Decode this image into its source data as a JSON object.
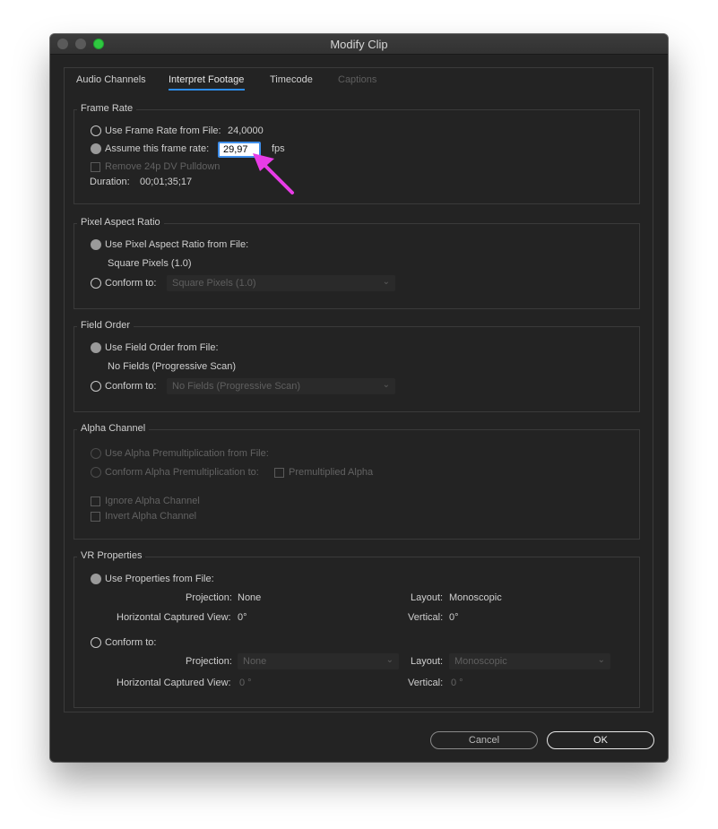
{
  "window": {
    "title": "Modify Clip"
  },
  "tabs": [
    "Audio Channels",
    "Interpret Footage",
    "Timecode",
    "Captions"
  ],
  "frame_rate": {
    "label": "Frame Rate",
    "use_file_label": "Use Frame Rate from File:",
    "use_file_value": "24,0000",
    "assume_label": "Assume this frame rate:",
    "assume_value": "29,97",
    "fps_unit": "fps",
    "pulldown_label": "Remove 24p DV Pulldown",
    "duration_label": "Duration:",
    "duration_value": "00;01;35;17"
  },
  "pixel_aspect": {
    "label": "Pixel Aspect Ratio",
    "use_file_label": "Use Pixel Aspect Ratio from File:",
    "file_value": "Square Pixels (1.0)",
    "conform_label": "Conform to:",
    "conform_value": "Square Pixels (1.0)"
  },
  "field_order": {
    "label": "Field Order",
    "use_file_label": "Use Field Order from File:",
    "file_value": "No Fields (Progressive Scan)",
    "conform_label": "Conform to:",
    "conform_value": "No Fields (Progressive Scan)"
  },
  "alpha": {
    "label": "Alpha Channel",
    "use_premult_label": "Use Alpha Premultiplication from File:",
    "conform_premult_label": "Conform Alpha Premultiplication to:",
    "premultiplied_label": "Premultiplied Alpha",
    "ignore_label": "Ignore Alpha Channel",
    "invert_label": "Invert Alpha Channel"
  },
  "vr": {
    "label": "VR Properties",
    "use_file_label": "Use Properties from File:",
    "projection_label": "Projection:",
    "projection_value": "None",
    "layout_label": "Layout:",
    "layout_value": "Monoscopic",
    "hcv_label": "Horizontal Captured View:",
    "hcv_value": "0°",
    "vertical_label": "Vertical:",
    "vertical_value": "0°",
    "conform_label": "Conform to:",
    "conform_projection": "None",
    "conform_layout": "Monoscopic",
    "conform_hcv": "0 °",
    "conform_vertical": "0 °"
  },
  "buttons": {
    "cancel": "Cancel",
    "ok": "OK"
  },
  "colors": {
    "accent": "#2d8ceb",
    "annotation_arrow": "#e83ce6"
  }
}
